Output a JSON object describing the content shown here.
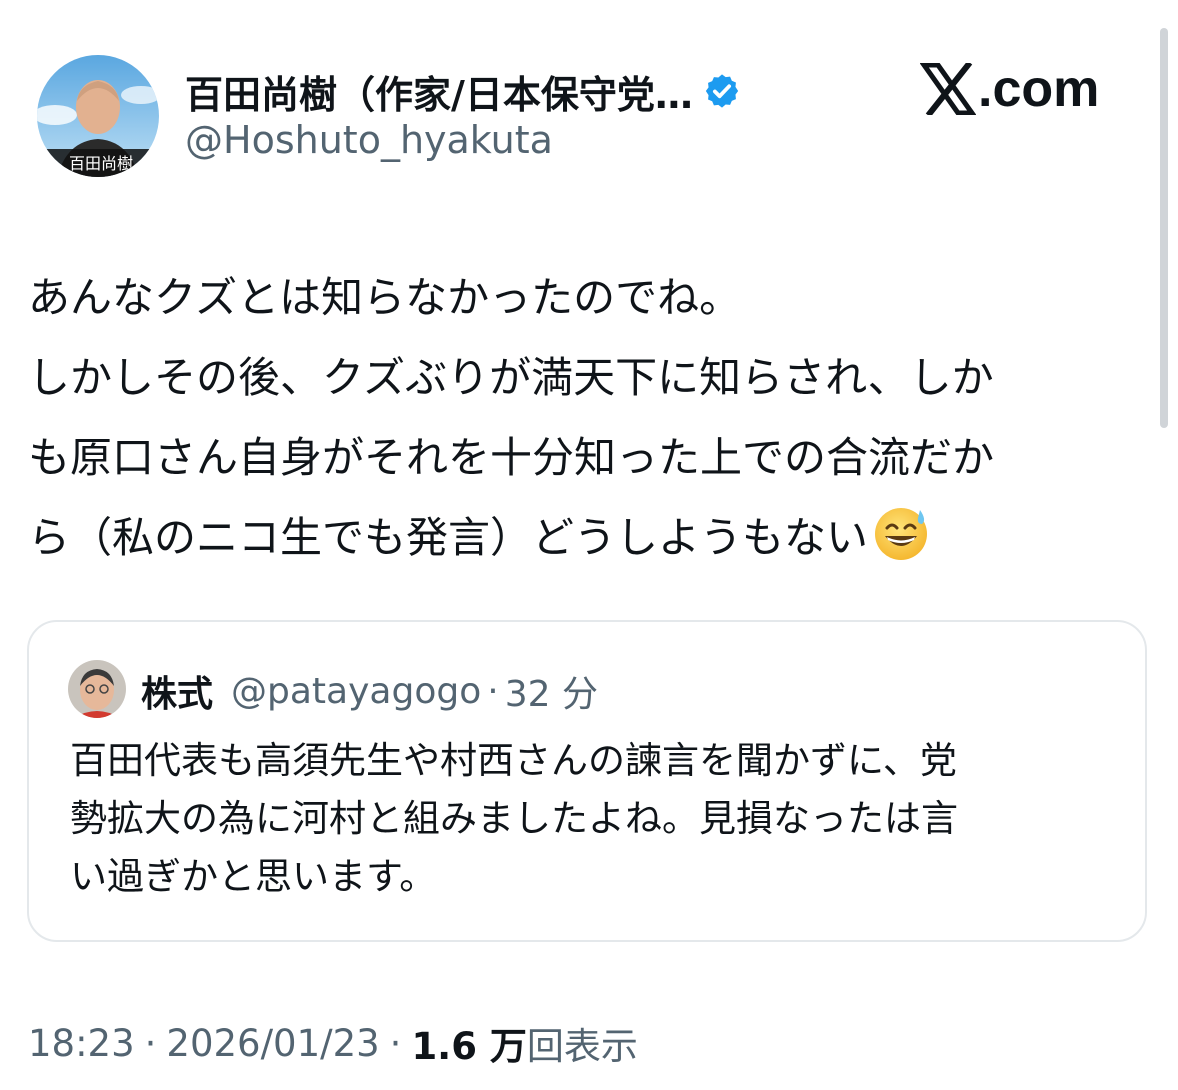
{
  "author": {
    "display_name": "百田尚樹（作家/日本保守党…",
    "handle": "@Hoshuto_hyakuta",
    "avatar_caption": "百田尚樹",
    "verified_icon": "verified-badge-icon"
  },
  "brand": {
    "text": ".com",
    "icon": "x-logo-icon"
  },
  "tweet": {
    "lines": [
      "あんなクズとは知らなかったのでね。",
      "しかしその後、クズぶりが満天下に知らされ、しか",
      "も原口さん自身がそれを十分知った上での合流だか",
      "ら（私のニコ生でも発言）どうしようもない"
    ],
    "emoji": "grinning-face-with-sweat"
  },
  "quote": {
    "name": "株式",
    "handle": "@patayagogo",
    "separator": "·",
    "time": "32 分",
    "lines": [
      "百田代表も高須先生や村西さんの諫言を聞かずに、党",
      "勢拡大の為に河村と組みましたよね。見損なったは言",
      "い過ぎかと思います。"
    ]
  },
  "meta": {
    "time": "18:23",
    "separator": "·",
    "date": "2026/01/23",
    "views_count": "1.6 万",
    "views_label": "回表示"
  },
  "colors": {
    "text": "#0f1419",
    "secondary": "#536471",
    "verified": "#1d9bf0",
    "border": "#e4e8eb"
  }
}
